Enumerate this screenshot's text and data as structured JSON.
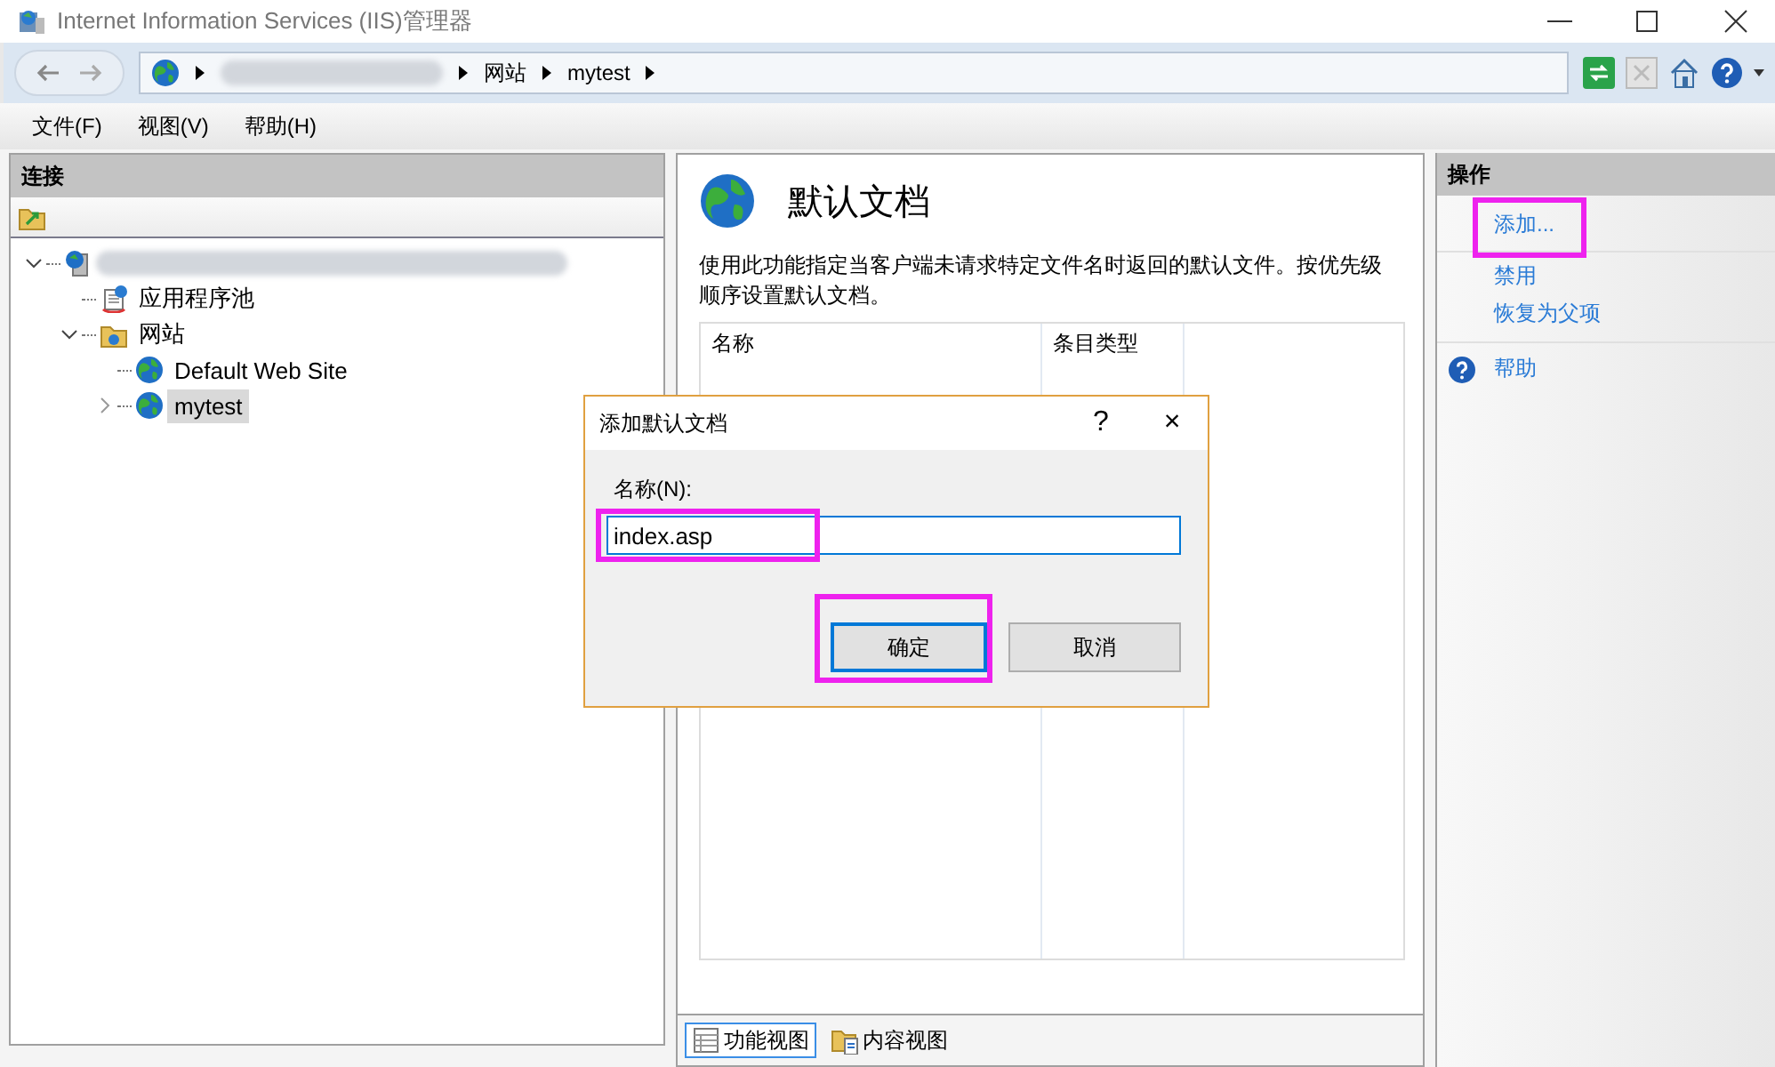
{
  "window": {
    "title": "Internet Information Services (IIS)管理器"
  },
  "breadcrumbs": [
    {
      "redacted": true
    },
    {
      "label": "网站"
    },
    {
      "label": "mytest"
    }
  ],
  "menu": [
    "文件(F)",
    "视图(V)",
    "帮助(H)"
  ],
  "connections": {
    "title": "连接",
    "tree": [
      {
        "redacted": true,
        "kind": "server",
        "expanded": true,
        "children": [
          {
            "label": "应用程序池",
            "kind": "pool",
            "selected": false
          },
          {
            "label": "网站",
            "kind": "folder",
            "expanded": true,
            "selected": false,
            "children": [
              {
                "label": "Default Web Site",
                "kind": "globe",
                "selected": false
              },
              {
                "label": "mytest",
                "kind": "globe",
                "expanded": false,
                "selected": true
              }
            ]
          }
        ]
      }
    ]
  },
  "feature": {
    "title": "默认文档",
    "description": "使用此功能指定当客户端未请求特定文件名时返回的默认文件。按优先级顺序设置默认文档。",
    "columns": [
      "名称",
      "条目类型"
    ]
  },
  "view_tabs": [
    {
      "label": "功能视图",
      "selected": true,
      "kind": "grid"
    },
    {
      "label": "内容视图",
      "selected": false,
      "kind": "folder"
    }
  ],
  "actions": {
    "title": "操作",
    "items": [
      {
        "label": "添加...",
        "kind": "link",
        "highlighted": true
      },
      {
        "label": "禁用",
        "kind": "link",
        "highlighted": false
      },
      {
        "label": "恢复为父项",
        "kind": "link",
        "highlighted": false
      },
      {
        "label": "帮助",
        "kind": "help",
        "highlighted": false
      }
    ]
  },
  "dialog": {
    "title": "添加默认文档",
    "help": "?",
    "close": "×",
    "field_label": "名称(N):",
    "value": "index.asp",
    "field_highlighted": true,
    "buttons": [
      {
        "label": "确定",
        "default": true,
        "highlighted": true
      },
      {
        "label": "取消",
        "default": false,
        "highlighted": false
      }
    ]
  }
}
